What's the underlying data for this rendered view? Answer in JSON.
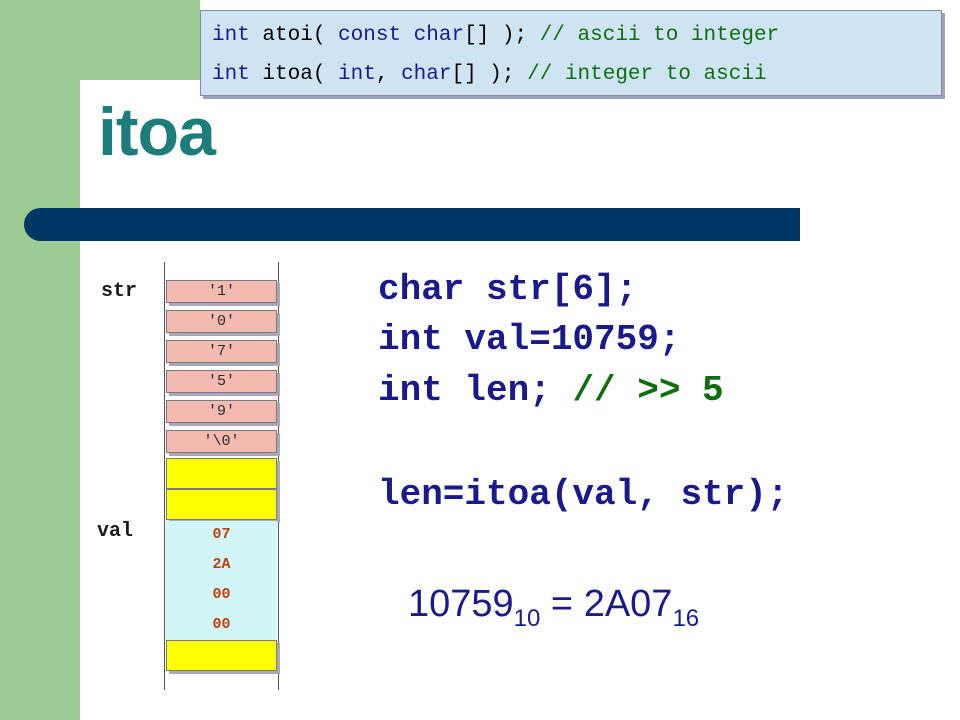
{
  "title": "itoa",
  "code_box": {
    "line1": {
      "a": "int",
      "b": " atoi( ",
      "c": "const",
      "d": " ",
      "e": "char",
      "f": "[] ); ",
      "g": "// ascii to integer"
    },
    "line2": {
      "a": "int",
      "b": " itoa( ",
      "c": "int",
      "d": ", ",
      "e": "char",
      "f": "[] ); ",
      "g": "// integer to ascii"
    }
  },
  "memory": {
    "str_label": "str",
    "val_label": "val",
    "str_cells": [
      "'1'",
      "'0'",
      "'7'",
      "'5'",
      "'9'",
      "'\\0'"
    ],
    "val_cells": [
      "07",
      "2A",
      "00",
      "00"
    ]
  },
  "code": {
    "line1": "char str[6];",
    "line2": "int val=10759;",
    "line3_code": "int len; ",
    "line3_comment": "// >> 5",
    "line4": "len=itoa(val, str);"
  },
  "equation": {
    "lhs": "10759",
    "lhs_base": "10",
    "op": " = ",
    "rhs": "2A07",
    "rhs_base": "16"
  },
  "colors": {
    "title": "#1d7d7a",
    "rule": "#003764",
    "sidebar": "#9ccc94",
    "str_cell": "#f4b9b0",
    "empty_cell": "#ffff00",
    "val_cell": "#d2f5f8",
    "val_text": "#c0400a",
    "code_text": "#1a1a8c",
    "comment_text": "#0f6e0f"
  }
}
